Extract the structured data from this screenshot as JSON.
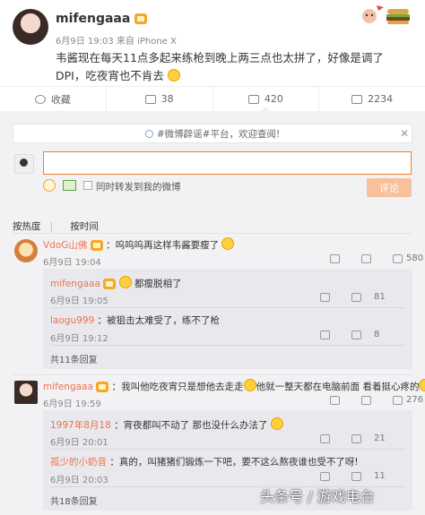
{
  "post": {
    "username": "mifengaaa",
    "meta": "6月9日 19:03 来自 iPhone X",
    "text": "韦酱现在每天11点多起来练枪到晚上两三点也太拼了，好像是调了DPI，吃夜宵也不肯去"
  },
  "actions": {
    "repost": "收藏",
    "forward_count": "38",
    "comment_count": "420",
    "like_count": "2234"
  },
  "notice": "#微博辟谣#平台，欢迎查阅!",
  "composer": {
    "repost_label": "同时转发到我的微博",
    "submit_label": "评论"
  },
  "sort": {
    "hot": "按热度",
    "time": "按时间"
  },
  "comments": [
    {
      "user": "VdoG山佛",
      "text": "：呜呜呜再这样韦酱要瘦了",
      "time": "6月9日 19:04",
      "likes": "580",
      "replies": [
        {
          "user": "mifengaaa",
          "text": "都瘦脱相了",
          "time": "6月9日 19:05",
          "likes": "81"
        },
        {
          "user": "laogu999",
          "text": "：被狙击太难受了，练不了枪",
          "time": "6月9日 19:12",
          "likes": "8"
        }
      ],
      "more": "共11条回复"
    },
    {
      "user": "mifengaaa",
      "text": "：我叫他吃夜宵只是想他去走走",
      "text2": "他就一整天都在电脑前面 看着挺心疼的",
      "time": "6月9日 19:59",
      "likes": "276",
      "replies": [
        {
          "user": "1997年8月18",
          "text": "：宵夜都叫不动了 那也没什么办法了",
          "time": "6月9日 20:01",
          "likes": "21"
        },
        {
          "user": "孤少的小奶音",
          "text": "：真的，叫猪猪们锻炼一下吧，要不这么熬夜谁也受不了呀!",
          "time": "6月9日 20:03",
          "likes": "11"
        }
      ],
      "more": "共18条回复"
    }
  ],
  "watermark": "头条号 / 游戏电台"
}
